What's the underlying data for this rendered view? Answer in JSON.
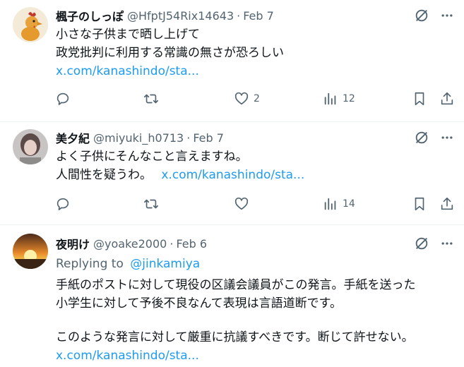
{
  "tweets": [
    {
      "name": "楓子のしっぽ",
      "handle": "@HfptJ54Rix14643",
      "sep": "·",
      "date": "Feb 7",
      "lines": [
        "小さな子供まで晒し上げて",
        "政党批判に利用する常識の無さが恐ろしい"
      ],
      "link": "x.com/kanashindo/sta...",
      "likes": "2",
      "views": "12"
    },
    {
      "name": "美夕紀",
      "handle": "@miyuki_h0713",
      "sep": "·",
      "date": "Feb 7",
      "lines": [
        "よく子供にそんなこと言えますね。",
        "人間性を疑うわ。"
      ],
      "link": "x.com/kanashindo/sta...",
      "likes": "",
      "views": "14"
    },
    {
      "name": "夜明け",
      "handle": "@yoake2000",
      "sep": "·",
      "date": "Feb 6",
      "replying_prefix": "Replying to",
      "replying_handle": "@jinkamiya",
      "lines": [
        "手紙のポストに対して現役の区議会議員がこの発言。手紙を送った",
        "小学生に対して予後不良なんて表現は言語道断です。",
        "このような発言に対して厳重に抗議すべきです。断じて許せない。"
      ],
      "link": "x.com/kanashindo/sta..."
    }
  ],
  "icons": {
    "grok": "grok-slash-circle-icon",
    "more": "more-dots-icon",
    "reply": "reply-icon",
    "retweet": "retweet-icon",
    "like": "heart-icon",
    "views": "views-icon",
    "bookmark": "bookmark-icon",
    "share": "share-icon"
  },
  "colors": {
    "text": "#0f1419",
    "secondary": "#536471",
    "link": "#1d9bf0",
    "divider": "#eff3f4"
  }
}
